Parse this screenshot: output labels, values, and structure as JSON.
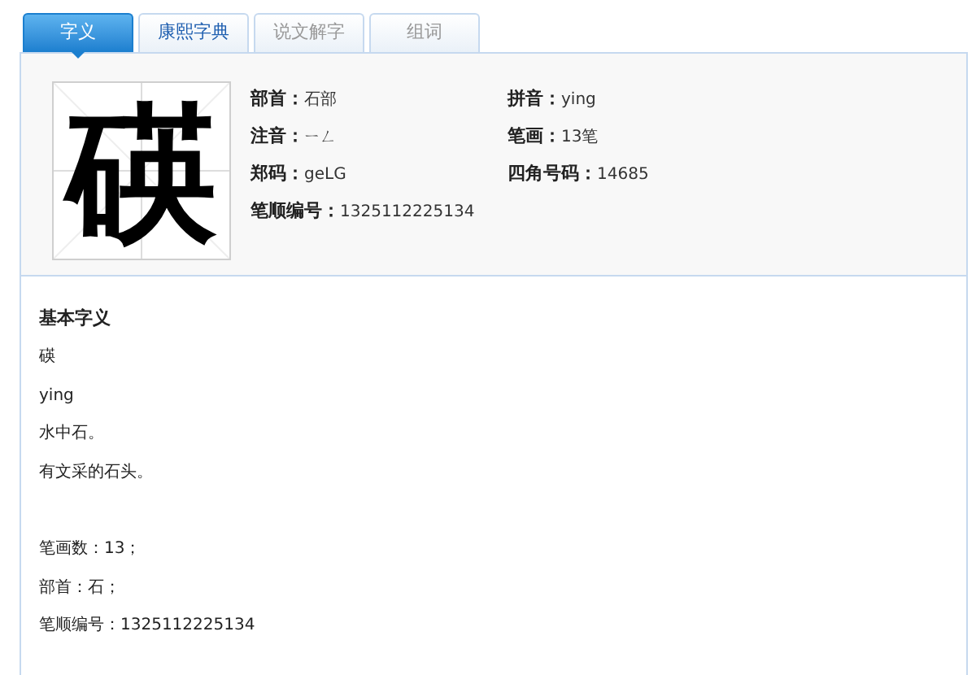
{
  "tabs": [
    {
      "label": "字义",
      "selected": true,
      "disabled": false
    },
    {
      "label": "康熙字典",
      "selected": false,
      "disabled": false
    },
    {
      "label": "说文解字",
      "selected": false,
      "disabled": true
    },
    {
      "label": "组词",
      "selected": false,
      "disabled": true
    }
  ],
  "character": "碤",
  "info_fields": [
    {
      "label": "部首：",
      "value": "石部"
    },
    {
      "label": "拼音：",
      "value": "ying"
    },
    {
      "label": "注音：",
      "value": "ㄧㄥ"
    },
    {
      "label": "笔画：",
      "value": "13笔"
    },
    {
      "label": "郑码：",
      "value": "geLG"
    },
    {
      "label": "四角号码：",
      "value": "14685"
    },
    {
      "label": "笔顺编号：",
      "value": "1325112225134"
    }
  ],
  "basic_meaning": {
    "title": "基本字义",
    "entries": [
      "碤",
      "ying",
      "水中石。",
      "有文采的石头。"
    ],
    "details": [
      "笔画数：13；",
      "部首：石；",
      "笔顺编号：1325112225134"
    ]
  }
}
